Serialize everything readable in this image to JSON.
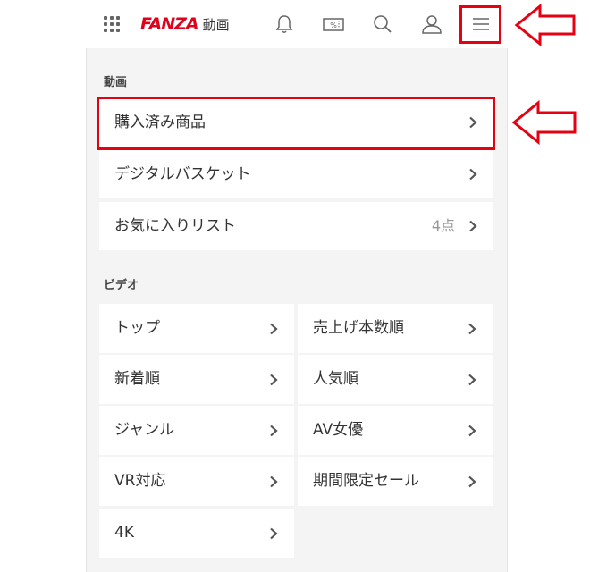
{
  "header": {
    "brand": "FANZA",
    "service": "動画",
    "icons": [
      "grid-menu-icon",
      "bell-icon",
      "coupon-icon",
      "search-icon",
      "user-icon",
      "hamburger-menu-icon"
    ]
  },
  "sections": {
    "douga": {
      "title": "動画",
      "items": [
        {
          "label": "購入済み商品",
          "count": ""
        },
        {
          "label": "デジタルバスケット",
          "count": ""
        },
        {
          "label": "お気に入りリスト",
          "count": "4点"
        }
      ]
    },
    "video": {
      "title": "ビデオ",
      "items": [
        {
          "label": "トップ"
        },
        {
          "label": "売上げ本数順"
        },
        {
          "label": "新着順"
        },
        {
          "label": "人気順"
        },
        {
          "label": "ジャンル"
        },
        {
          "label": "AV女優"
        },
        {
          "label": "VR対応"
        },
        {
          "label": "期間限定セール"
        },
        {
          "label": "4K"
        }
      ]
    }
  },
  "colors": {
    "brand": "#e0001b",
    "highlight": "#e50012",
    "panel_bg": "#f4f4f4"
  }
}
